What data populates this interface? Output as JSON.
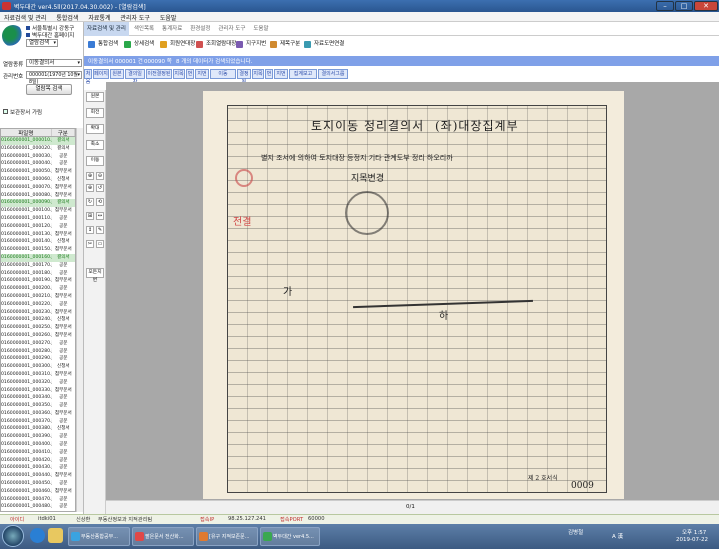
{
  "window": {
    "title": "벽두대간 ver4.5ll(2017.04.30.002) - [열람검색]",
    "buttons": [
      "–",
      "□",
      "✕"
    ]
  },
  "menubar": [
    "자료검색 및 관리",
    "통합검색",
    "자료통계",
    "관리자 도구",
    "도움말"
  ],
  "left": {
    "org_lines": [
      "서울특별시 강동구",
      "벽두대간 홈페이지"
    ],
    "mode_select": "열람검색",
    "category_label": "열람종류",
    "category_value": "이동결의서",
    "number_label": "관리번호",
    "number_value": "000001(1970년 10월 8일)",
    "search_button": "열람목 검색",
    "checkbox_label": "보관장서 가림",
    "list_headers": [
      "파일명",
      "구분"
    ],
    "files": [
      {
        "name": "0160000001_000010.jpg",
        "type": "결의서",
        "highlight": true
      },
      {
        "name": "0160000001_000020.jpg",
        "type": "결의서",
        "highlight": false
      },
      {
        "name": "0160000001_000030.jpg",
        "type": "공문",
        "highlight": false
      },
      {
        "name": "0160000001_000040.jpg",
        "type": "공문",
        "highlight": false
      },
      {
        "name": "0160000001_000050.jpg",
        "type": "첨부문서",
        "highlight": false
      },
      {
        "name": "0160000001_000060.jpg",
        "type": "신청서",
        "highlight": false
      },
      {
        "name": "0160000001_000070.jpg",
        "type": "첨부문서",
        "highlight": false
      },
      {
        "name": "0160000001_000080.jpg",
        "type": "첨부문서",
        "highlight": false
      },
      {
        "name": "0160000001_000090.jpg",
        "type": "결의서",
        "highlight": true
      },
      {
        "name": "0160000001_000100.jpg",
        "type": "첨부문서",
        "highlight": false
      },
      {
        "name": "0160000001_000110.jpg",
        "type": "공문",
        "highlight": false
      },
      {
        "name": "0160000001_000120.jpg",
        "type": "공문",
        "highlight": false
      },
      {
        "name": "0160000001_000130.jpg",
        "type": "첨부문서",
        "highlight": false
      },
      {
        "name": "0160000001_000140.jpg",
        "type": "신청서",
        "highlight": false
      },
      {
        "name": "0160000001_000150.jpg",
        "type": "첨부문서",
        "highlight": false
      },
      {
        "name": "0160000001_000160.jpg",
        "type": "결의서",
        "highlight": true
      },
      {
        "name": "0160000001_000170.jpg",
        "type": "공문",
        "highlight": false
      },
      {
        "name": "0160000001_000180.jpg",
        "type": "공문",
        "highlight": false
      },
      {
        "name": "0160000001_000190.jpg",
        "type": "첨부문서",
        "highlight": false
      },
      {
        "name": "0160000001_000200.jpg",
        "type": "공문",
        "highlight": false
      },
      {
        "name": "0160000001_000210.jpg",
        "type": "첨부문서",
        "highlight": false
      },
      {
        "name": "0160000001_000220.jpg",
        "type": "공문",
        "highlight": false
      },
      {
        "name": "0160000001_000230.jpg",
        "type": "첨부문서",
        "highlight": false
      },
      {
        "name": "0160000001_000240.jpg",
        "type": "신청서",
        "highlight": false
      },
      {
        "name": "0160000001_000250.jpg",
        "type": "첨부문서",
        "highlight": false
      },
      {
        "name": "0160000001_000260.jpg",
        "type": "첨부문서",
        "highlight": false
      },
      {
        "name": "0160000001_000270.jpg",
        "type": "공문",
        "highlight": false
      },
      {
        "name": "0160000001_000280.jpg",
        "type": "공문",
        "highlight": false
      },
      {
        "name": "0160000001_000290.jpg",
        "type": "공문",
        "highlight": false
      },
      {
        "name": "0160000001_000300.jpg",
        "type": "신청서",
        "highlight": false
      },
      {
        "name": "0160000001_000310.jpg",
        "type": "첨부문서",
        "highlight": false
      },
      {
        "name": "0160000001_000320.jpg",
        "type": "공문",
        "highlight": false
      },
      {
        "name": "0160000001_000330.jpg",
        "type": "첨부문서",
        "highlight": false
      },
      {
        "name": "0160000001_000340.jpg",
        "type": "공문",
        "highlight": false
      },
      {
        "name": "0160000001_000350.jpg",
        "type": "공문",
        "highlight": false
      },
      {
        "name": "0160000001_000360.jpg",
        "type": "첨부문서",
        "highlight": false
      },
      {
        "name": "0160000001_000370.jpg",
        "type": "공문",
        "highlight": false
      },
      {
        "name": "0160000001_000380.jpg",
        "type": "신청서",
        "highlight": false
      },
      {
        "name": "0160000001_000390.jpg",
        "type": "공문",
        "highlight": false
      },
      {
        "name": "0160000001_000400.jpg",
        "type": "공문",
        "highlight": false
      },
      {
        "name": "0160000001_000410.jpg",
        "type": "공문",
        "highlight": false
      },
      {
        "name": "0160000001_000420.jpg",
        "type": "공문",
        "highlight": false
      },
      {
        "name": "0160000001_000430.jpg",
        "type": "공문",
        "highlight": false
      },
      {
        "name": "0160000001_000440.jpg",
        "type": "첨부문서",
        "highlight": false
      },
      {
        "name": "0160000001_000450.jpg",
        "type": "공문",
        "highlight": false
      },
      {
        "name": "0160000001_000460.jpg",
        "type": "첨부문서",
        "highlight": false
      },
      {
        "name": "0160000001_000470.jpg",
        "type": "공문",
        "highlight": false
      },
      {
        "name": "0160000001_000480.jpg",
        "type": "공문",
        "highlight": false
      },
      {
        "name": "0160000001_000490.jpg",
        "type": "공문",
        "highlight": false
      }
    ]
  },
  "tools": {
    "buttons": [
      "원본",
      "회전",
      "확대",
      "축소",
      "이동"
    ],
    "extra_button": "모든지번",
    "grid": [
      "⊕",
      "⊖",
      "⊕",
      "↺",
      "↻",
      "⟲",
      "⊞",
      "↔",
      "↕",
      "✎",
      "✂",
      "▭"
    ]
  },
  "tabs": [
    "자료검색 및 관리",
    "색인목록",
    "통계자료",
    "환경설정",
    "관리자 도구",
    "도움말"
  ],
  "toolbar": [
    "통합검색",
    "상세검색",
    "회원연대장",
    "조회열람대장",
    "지구지번",
    "제목구분",
    "자료도면연결"
  ],
  "searchbar": {
    "summary": "이동결의서 000001 건",
    "count": "000090 쪽",
    "message": "8 개의 데이터가 검색되었습니다."
  },
  "pagebar": [
    "처음",
    "페이지",
    "원본",
    "결의일자",
    "이전결정된",
    "지목",
    "번",
    "지번",
    "이동",
    "결정된",
    "지목",
    "번",
    "지번",
    "집계보고",
    "결의서그룹"
  ],
  "document": {
    "title": "토지이동 정리결의서",
    "subtitle": "(좌)대장집계부",
    "header_text": "별지 조서에 의하여 토지대장 등정지 기타 관계도부 정리 하오리까",
    "stamp": "전결",
    "hand1": "가",
    "hand2": "지목변경",
    "hand3": "하",
    "number": "0009",
    "page_mark": "제 2 호서식"
  },
  "viewer_footer": "0/1",
  "status": [
    "아이디",
    "itdki01",
    "신상환",
    "부동산정보과 지적관리팀",
    "접속IP",
    "98.25.127.241",
    "접속PORT",
    "60000"
  ],
  "taskbar": {
    "items": [
      "부동산종합공부...",
      "팔은문서 전산화...",
      "[유구 지적보존문...",
      "벽두대간 ver4.5..."
    ],
    "tray_user": "김병철",
    "lang": "A 漢",
    "time": "오후 1:57",
    "date": "2019-07-22"
  },
  "colors": {
    "titlebar": "#2a5690",
    "search_band": "#7fa0e8",
    "highlight_row": "#cfe9cf",
    "taskbar": "#3c5a82"
  }
}
